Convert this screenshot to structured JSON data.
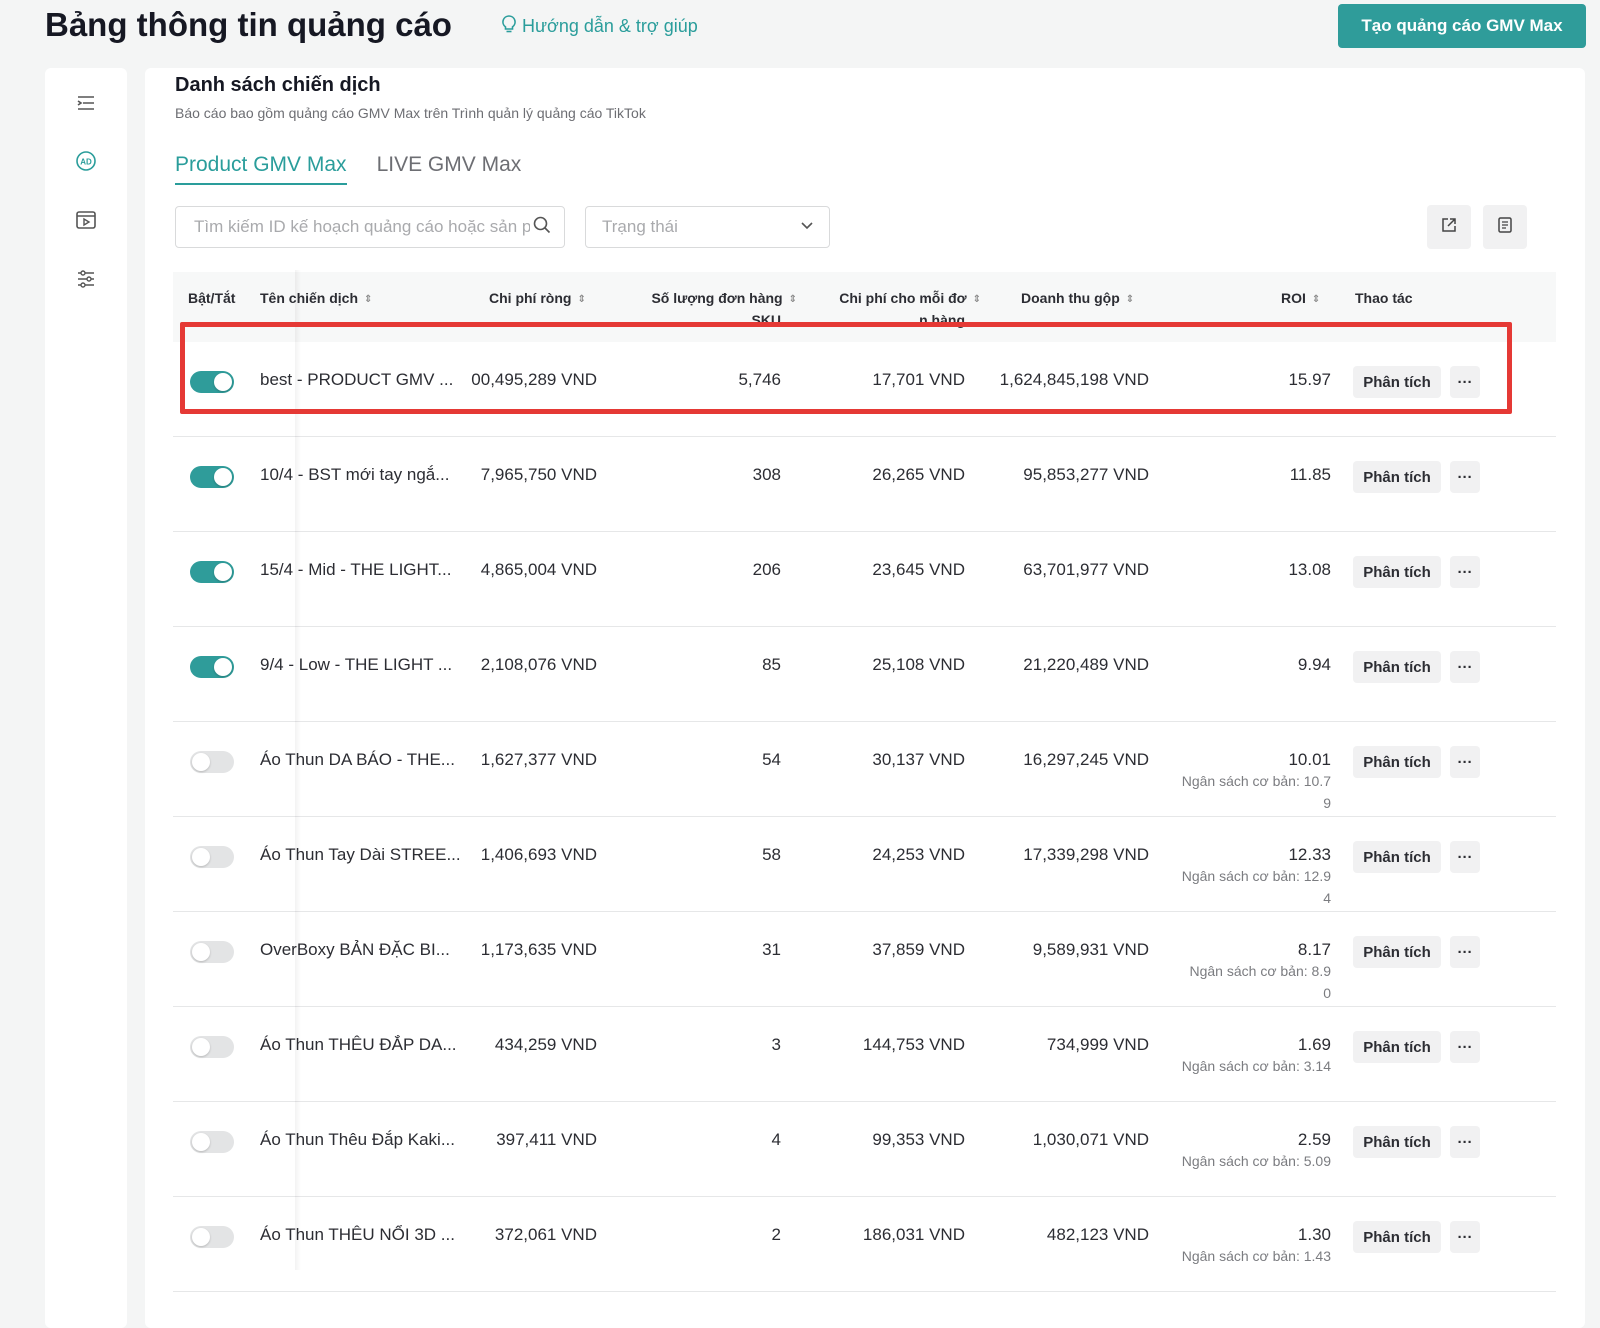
{
  "header": {
    "title": "Bảng thông tin quảng cáo",
    "help_label": "Hướng dẫn & trợ giúp",
    "create_button": "Tạo quảng cáo GMV Max"
  },
  "rail": {
    "icons": [
      "menu-icon",
      "ad-icon",
      "video-icon",
      "filter-icon"
    ]
  },
  "panel": {
    "title": "Danh sách chiến dịch",
    "subtitle": "Báo cáo bao gồm quảng cáo GMV Max trên Trình quản lý quảng cáo TikTok",
    "tabs": [
      {
        "label": "Product GMV Max",
        "active": true
      },
      {
        "label": "LIVE GMV Max",
        "active": false
      }
    ],
    "search": {
      "placeholder": "Tìm kiếm ID kế hoạch quảng cáo hoặc sản phẩm"
    },
    "status_filter": {
      "placeholder": "Trạng thái"
    }
  },
  "columns": {
    "toggle": "Bật/Tắt",
    "name": "Tên chiến dịch",
    "net_cost": "Chi phí ròng",
    "orders_line1": "Số lượng đơn hàng",
    "orders_line2": "SKU",
    "cpo_line1": "Chi phí cho mỗi đơ",
    "cpo_line2": "n hàng",
    "revenue": "Doanh thu gộp",
    "roi": "ROI",
    "actions": "Thao tác"
  },
  "rows": [
    {
      "on": true,
      "name": "best - PRODUCT GMV ...",
      "net_cost": "00,495,289 VND",
      "orders": "5,746",
      "cpo": "17,701 VND",
      "revenue": "1,624,845,198 VND",
      "roi": "15.97",
      "roi_note_1": "",
      "roi_note_2": "",
      "action": "Phân tích",
      "more": "···"
    },
    {
      "on": true,
      "name": "10/4 - BST mới tay ngắ...",
      "net_cost": "7,965,750 VND",
      "orders": "308",
      "cpo": "26,265 VND",
      "revenue": "95,853,277 VND",
      "roi": "11.85",
      "roi_note_1": "",
      "roi_note_2": "",
      "action": "Phân tích",
      "more": "···"
    },
    {
      "on": true,
      "name": "15/4 - Mid - THE LIGHT...",
      "net_cost": "4,865,004 VND",
      "orders": "206",
      "cpo": "23,645 VND",
      "revenue": "63,701,977 VND",
      "roi": "13.08",
      "roi_note_1": "",
      "roi_note_2": "",
      "action": "Phân tích",
      "more": "···"
    },
    {
      "on": true,
      "name": "9/4 - Low - THE LIGHT ...",
      "net_cost": "2,108,076 VND",
      "orders": "85",
      "cpo": "25,108 VND",
      "revenue": "21,220,489 VND",
      "roi": "9.94",
      "roi_note_1": "",
      "roi_note_2": "",
      "action": "Phân tích",
      "more": "···"
    },
    {
      "on": false,
      "name": "Áo Thun DA BÁO - THE...",
      "net_cost": "1,627,377 VND",
      "orders": "54",
      "cpo": "30,137 VND",
      "revenue": "16,297,245 VND",
      "roi": "10.01",
      "roi_note_1": "Ngân sách cơ bản: 10.7",
      "roi_note_2": "9",
      "action": "Phân tích",
      "more": "···"
    },
    {
      "on": false,
      "name": "Áo Thun Tay Dài STREE...",
      "net_cost": "1,406,693 VND",
      "orders": "58",
      "cpo": "24,253 VND",
      "revenue": "17,339,298 VND",
      "roi": "12.33",
      "roi_note_1": "Ngân sách cơ bản: 12.9",
      "roi_note_2": "4",
      "action": "Phân tích",
      "more": "···"
    },
    {
      "on": false,
      "name": "OverBoxy BẢN ĐẶC BI...",
      "net_cost": "1,173,635 VND",
      "orders": "31",
      "cpo": "37,859 VND",
      "revenue": "9,589,931 VND",
      "roi": "8.17",
      "roi_note_1": "Ngân sách cơ bản: 8.9",
      "roi_note_2": "0",
      "action": "Phân tích",
      "more": "···"
    },
    {
      "on": false,
      "name": "Áo Thun THÊU ĐẮP DA...",
      "net_cost": "434,259 VND",
      "orders": "3",
      "cpo": "144,753 VND",
      "revenue": "734,999 VND",
      "roi": "1.69",
      "roi_note_1": "Ngân sách cơ bản: 3.14",
      "roi_note_2": "",
      "action": "Phân tích",
      "more": "···"
    },
    {
      "on": false,
      "name": "Áo Thun Thêu Đắp Kaki...",
      "net_cost": "397,411 VND",
      "orders": "4",
      "cpo": "99,353 VND",
      "revenue": "1,030,071 VND",
      "roi": "2.59",
      "roi_note_1": "Ngân sách cơ bản: 5.09",
      "roi_note_2": "",
      "action": "Phân tích",
      "more": "···"
    },
    {
      "on": false,
      "name": "Áo Thun THÊU NỔI 3D ...",
      "net_cost": "372,061 VND",
      "orders": "2",
      "cpo": "186,031 VND",
      "revenue": "482,123 VND",
      "roi": "1.30",
      "roi_note_1": "Ngân sách cơ bản: 1.43",
      "roi_note_2": "",
      "action": "Phân tích",
      "more": "···"
    }
  ],
  "colors": {
    "accent": "#2f9c9a",
    "highlight": "#e53935"
  }
}
